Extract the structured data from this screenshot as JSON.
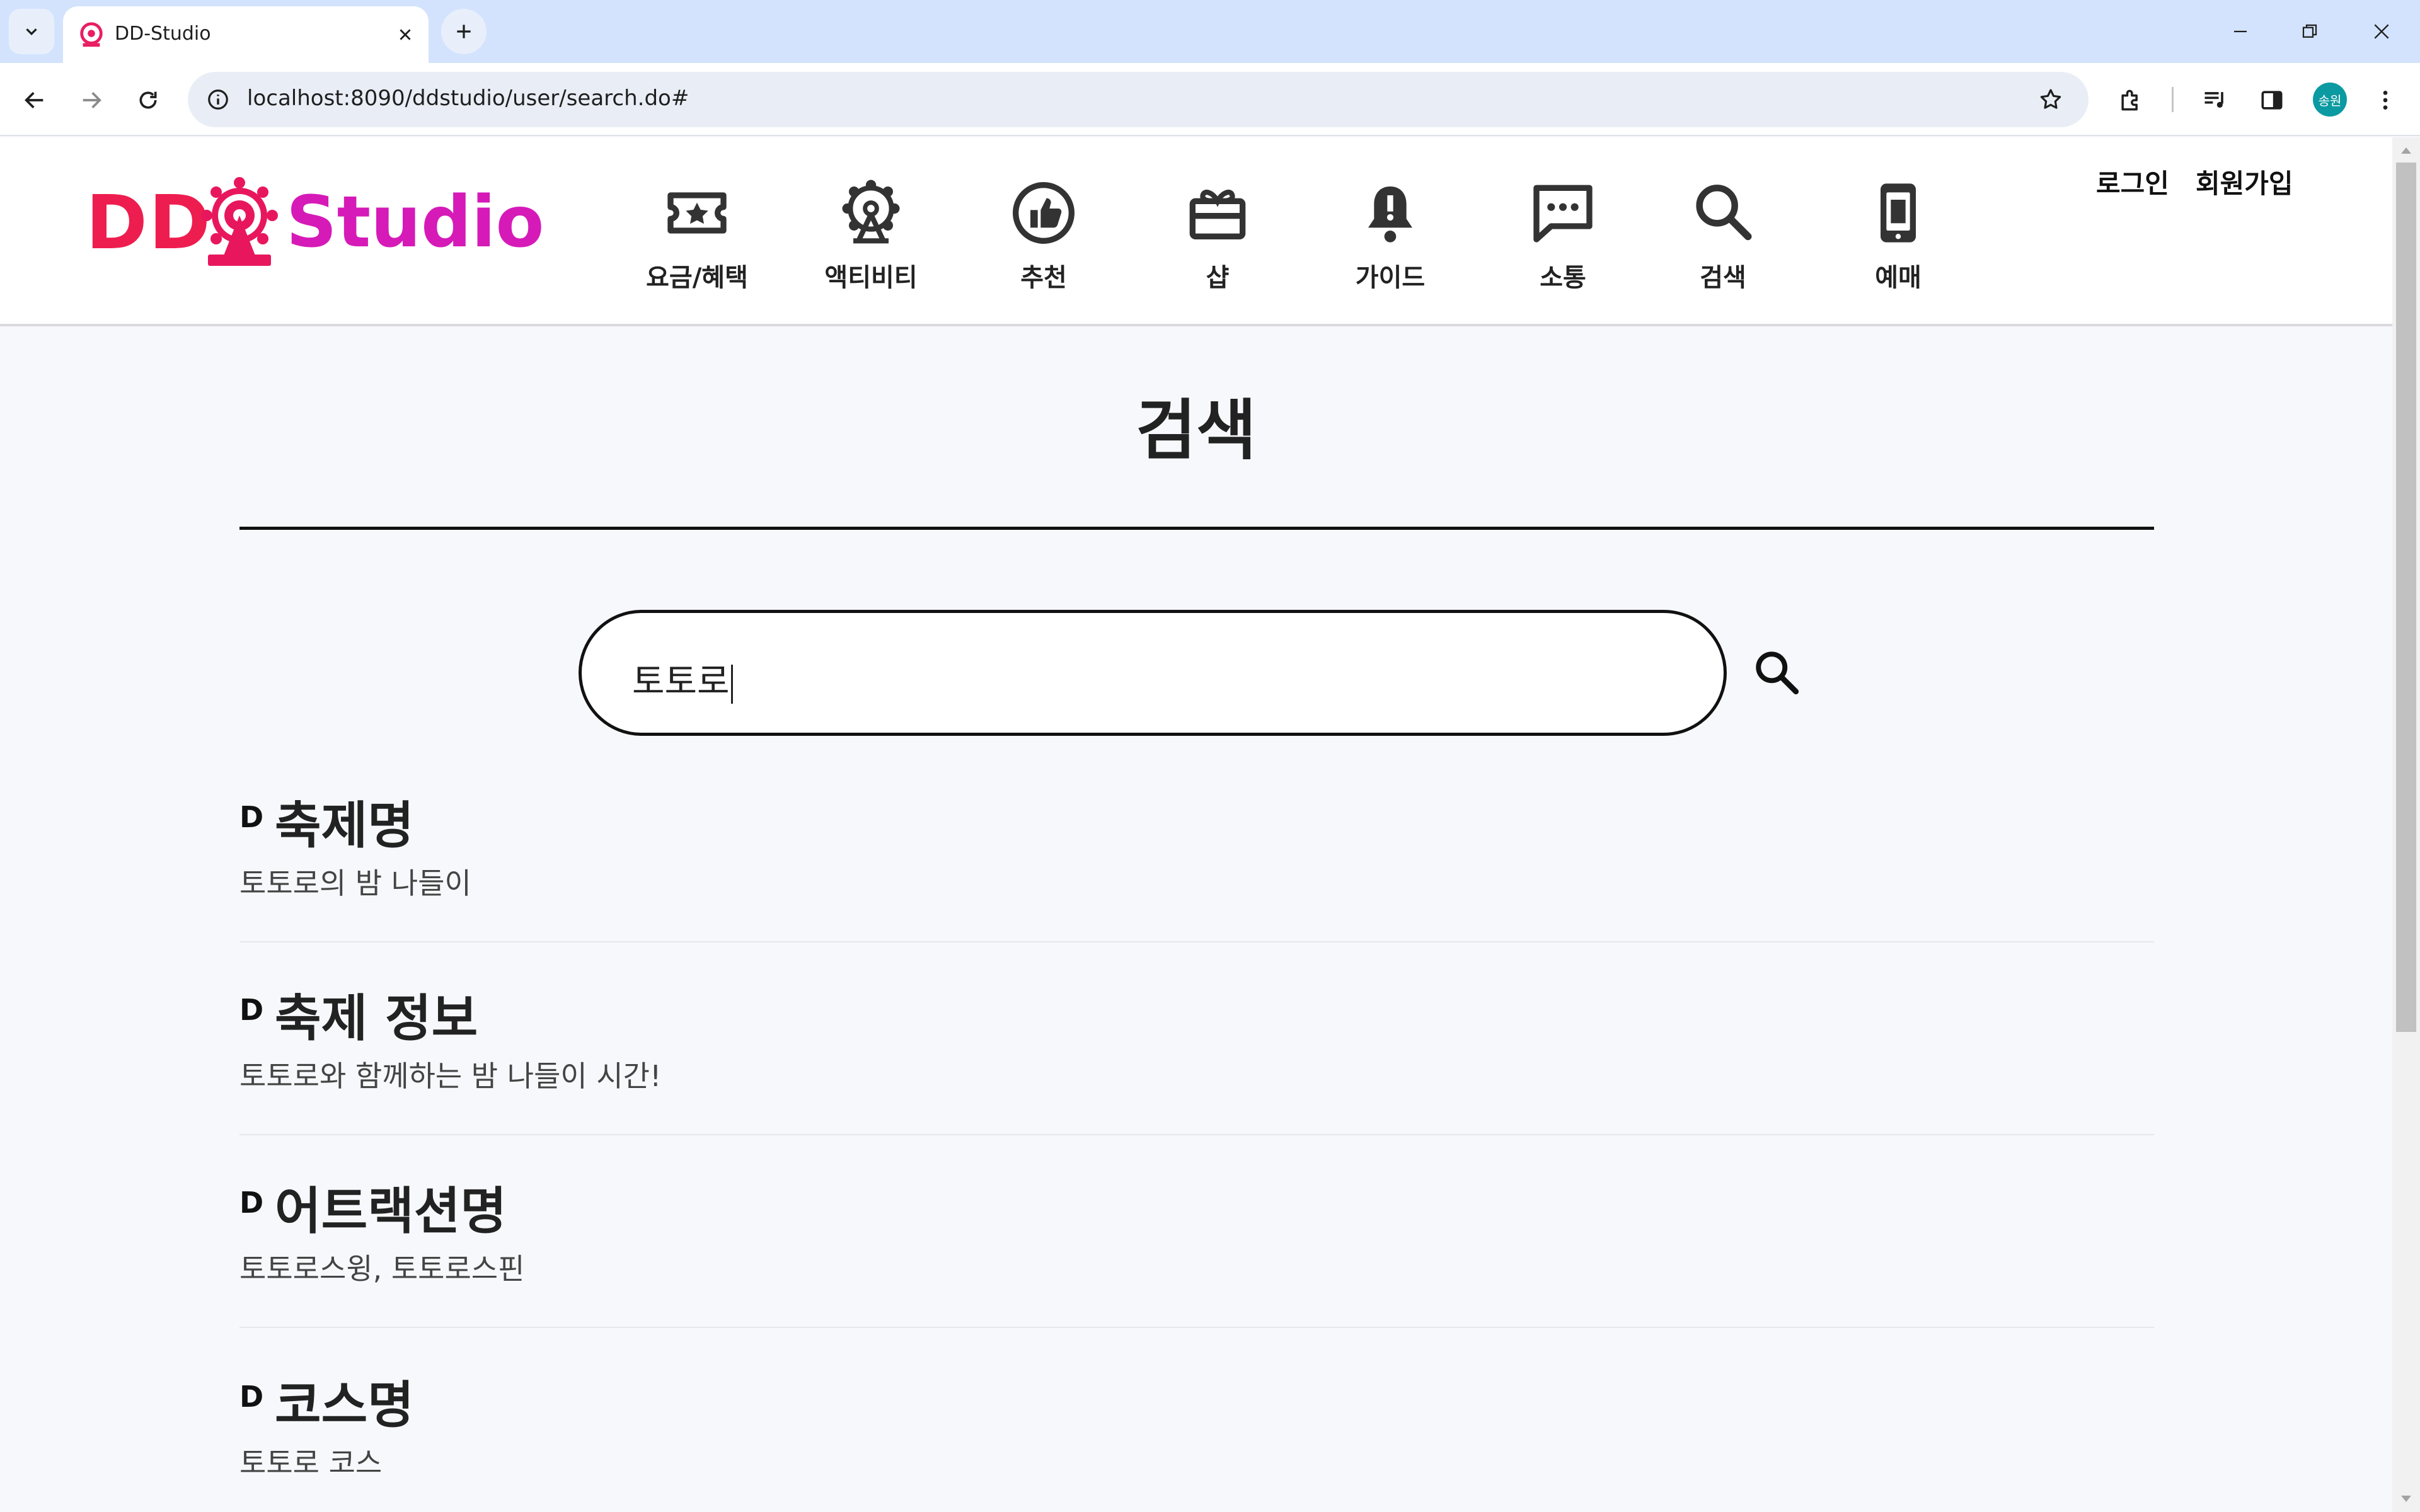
{
  "browser": {
    "tab_title": "DD-Studio",
    "url": "localhost:8090/ddstudio/user/search.do#",
    "profile_initials": "송원"
  },
  "site": {
    "logo_left": "DD",
    "logo_right": "Studio",
    "nav": [
      {
        "label": "요금/혜택",
        "icon": "ticket-icon"
      },
      {
        "label": "액티비티",
        "icon": "ferris-wheel-icon"
      },
      {
        "label": "추천",
        "icon": "thumbs-up-icon"
      },
      {
        "label": "샵",
        "icon": "gift-icon"
      },
      {
        "label": "가이드",
        "icon": "bell-icon"
      },
      {
        "label": "소통",
        "icon": "chat-icon"
      },
      {
        "label": "검색",
        "icon": "search-icon"
      },
      {
        "label": "예매",
        "icon": "mobile-ticket-icon"
      }
    ],
    "auth": {
      "login": "로그인",
      "signup": "회원가입"
    }
  },
  "page": {
    "title": "검색",
    "search_value": "토토로"
  },
  "results": [
    {
      "bullet": "D",
      "heading": "축제명",
      "text": "토토로의 밤 나들이"
    },
    {
      "bullet": "D",
      "heading": "축제 정보",
      "text": "토토로와 함께하는 밤 나들이 시간!"
    },
    {
      "bullet": "D",
      "heading": "어트랙션명",
      "text": "토토로스윙, 토토로스핀"
    },
    {
      "bullet": "D",
      "heading": "코스명",
      "text": "토토로 코스"
    }
  ],
  "colors": {
    "logo_red": "#ee1d4f",
    "logo_magenta": "#d61ab8",
    "icon_dark": "#333333",
    "page_bg": "#f7f8fc"
  }
}
